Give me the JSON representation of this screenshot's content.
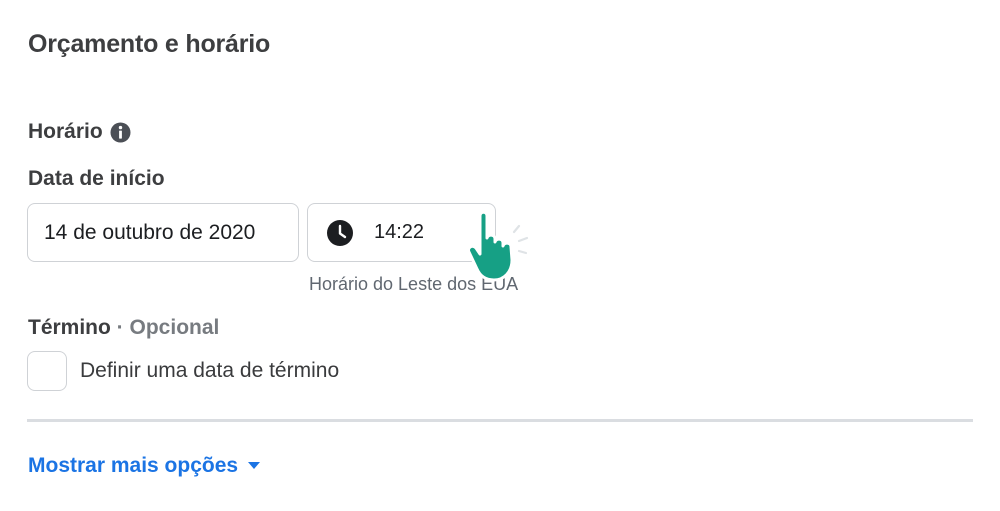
{
  "section": {
    "title": "Orçamento e horário"
  },
  "schedule": {
    "label": "Horário",
    "info_icon": "info-icon",
    "start_label": "Data de início",
    "start_date_value": "14 de outubro de 2020",
    "start_time_value": "14:22",
    "clock_icon": "clock-icon",
    "timezone": "Horário do Leste dos EUA",
    "end_label": "Término",
    "end_separator": " · ",
    "end_optional": "Opcional",
    "end_checkbox_label": "Definir uma data de término",
    "end_checkbox_checked": false
  },
  "footer": {
    "more_options_label": "Mostrar mais opções",
    "caret_icon": "caret-down-icon"
  },
  "colors": {
    "link": "#1b74e4",
    "pointer_hand": "#16a085",
    "border": "#cfd2d6"
  }
}
